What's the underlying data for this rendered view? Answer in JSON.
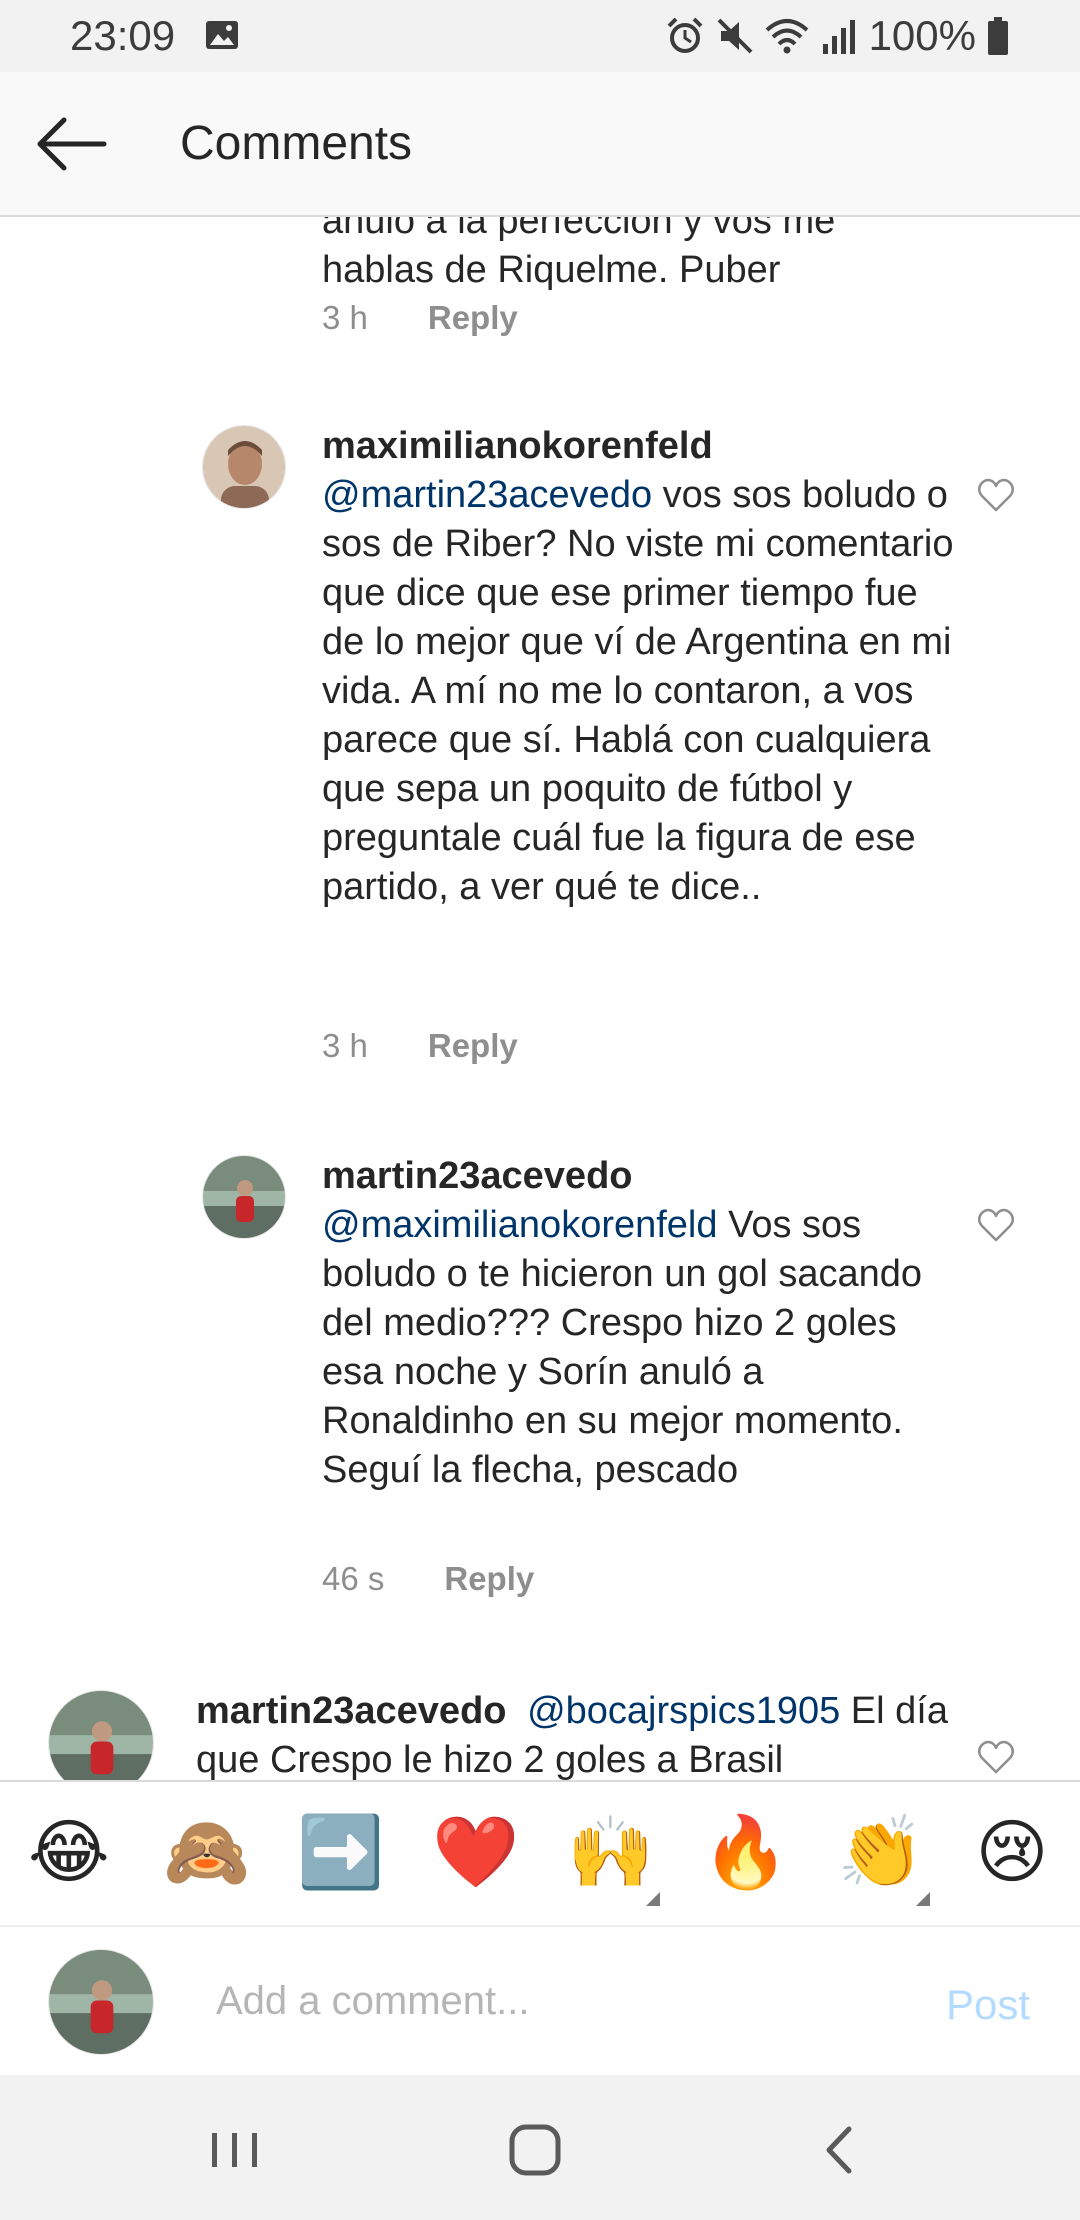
{
  "status_bar": {
    "time": "23:09",
    "battery": "100%",
    "icons": [
      "image-icon",
      "alarm-icon",
      "mute-icon",
      "wifi-icon",
      "signal-icon",
      "battery-icon"
    ]
  },
  "header": {
    "title": "Comments",
    "back_icon": "arrow-left-icon"
  },
  "comments": {
    "partial": {
      "line1": "anuló a la perfección y vos me",
      "line2": "hablas de Riquelme. Puber",
      "time": "3 h",
      "reply": "Reply"
    },
    "items": [
      {
        "username": "maximilianokorenfeld",
        "mention": "@martin23acevedo",
        "text": " vos sos boludo o sos de Riber? No viste mi comentario que dice que ese primer tiempo fue de lo mejor que ví de Argentina en mi vida. A mí no me lo contaron, a vos parece que sí. Hablá con cualquiera que sepa un poquito de fútbol y preguntale cuál fue la figura de ese partido, a ver qué te dice..",
        "time": "3 h",
        "reply": "Reply"
      },
      {
        "username": "martin23acevedo",
        "mention": "@maximilianokorenfeld",
        "text": " Vos sos boludo o te hicieron un gol sacando del medio??? Crespo hizo 2 goles esa noche y Sorín anuló a Ronaldinho en su mejor momento. Seguí la flecha, pescado",
        "time": "46 s",
        "reply": "Reply"
      },
      {
        "username": "martin23acevedo",
        "mention": "@bocajrspics1905",
        "text": " El día que Crespo le hizo 2 goles a Brasil"
      }
    ]
  },
  "emoji_bar": {
    "emojis": [
      "😂",
      "🙈",
      "➡️",
      "❤️",
      "🙌",
      "🔥",
      "👏",
      "😢"
    ]
  },
  "composer": {
    "placeholder": "Add a comment...",
    "post_label": "Post"
  },
  "colors": {
    "mention": "#003569",
    "meta": "#8e8e8e",
    "post_disabled": "#b3dbff"
  }
}
